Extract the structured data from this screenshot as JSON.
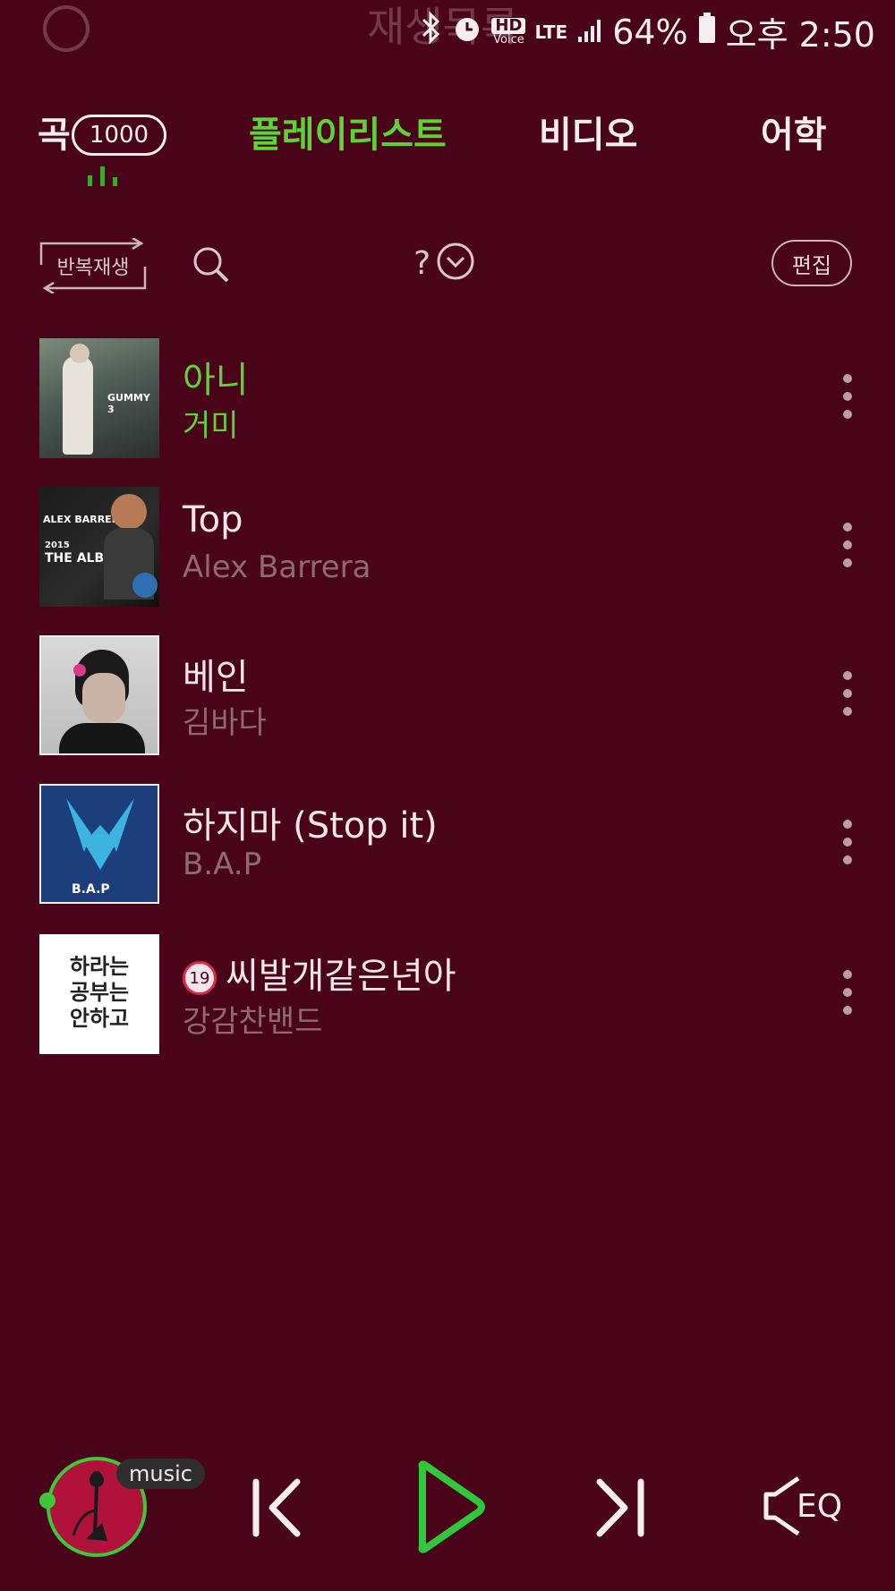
{
  "status_bar": {
    "faded_title": "재생목록",
    "network": "LTE",
    "hd_label": "HD",
    "voice_label": "Voice",
    "battery": "64%",
    "time": "오후 2:50"
  },
  "tabs": {
    "song": "곡",
    "song_count": "1000",
    "playlist": "플레이리스트",
    "video": "비디오",
    "language": "어학"
  },
  "toolbar": {
    "repeat_label": "반복재생",
    "sort_label": "?",
    "edit_label": "편집"
  },
  "songs": [
    {
      "title": "아니",
      "artist": "거미",
      "active": true
    },
    {
      "title": "Top",
      "artist": "Alex Barrera",
      "active": false
    },
    {
      "title": "베인",
      "artist": "김바다",
      "active": false
    },
    {
      "title": "하지마 (Stop it)",
      "artist": "B.A.P",
      "active": false
    },
    {
      "title": "씨발개같은년아",
      "artist": "강감찬밴드",
      "active": false,
      "age_rating": "19"
    }
  ],
  "album_art_text": {
    "gummy": "GUMMY 3",
    "alex_name": "ALEX BARRERA",
    "alex_year": "2015",
    "alex_album": "THE ALBUM",
    "bap": "B.A.P",
    "gangam_line1": "하라는",
    "gangam_line2": "공부는",
    "gangam_line3": "안하고"
  },
  "player": {
    "music_tag": "music",
    "eq_label": "EQ"
  },
  "colors": {
    "background": "#4a0419",
    "accent": "#5ed335",
    "play_green": "#2fc83a"
  }
}
